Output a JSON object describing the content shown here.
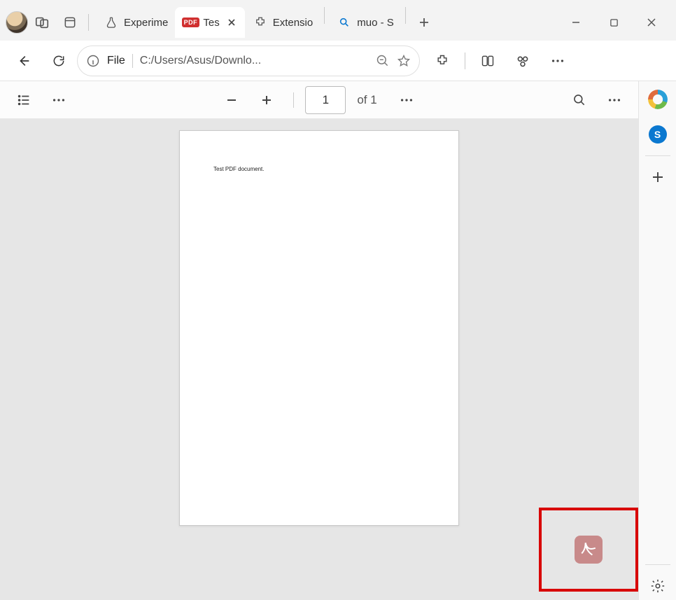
{
  "tabs": [
    {
      "label": "Experime",
      "icon": "flask-icon"
    },
    {
      "label": "Tes",
      "icon": "pdf-icon",
      "active": true,
      "closeable": true,
      "pdf_badge": "PDF"
    },
    {
      "label": "Extensio",
      "icon": "extension-icon"
    },
    {
      "label": "muo - S",
      "icon": "search-icon"
    }
  ],
  "addressbar": {
    "scheme_label": "File",
    "url": "C:/Users/Asus/Downlo..."
  },
  "pdf_toolbar": {
    "current_page": "1",
    "page_total_label": "of 1"
  },
  "document": {
    "body_text": "Test PDF document."
  },
  "sidebar": {
    "skype_initial": "S"
  }
}
